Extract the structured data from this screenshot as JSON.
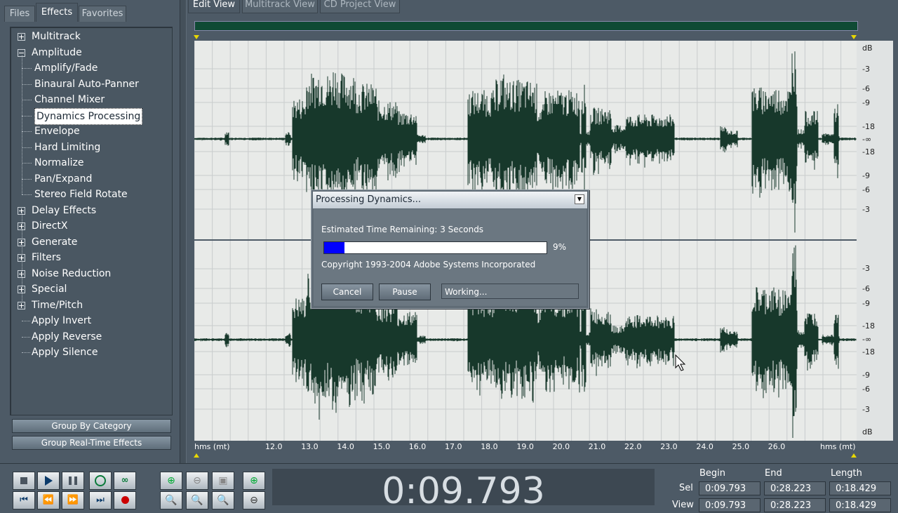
{
  "left_panel": {
    "tabs": [
      "Files",
      "Effects",
      "Favorites"
    ],
    "active_tab": "Effects",
    "tree": [
      {
        "label": "Multitrack",
        "level": 0,
        "expander": "plus"
      },
      {
        "label": "Amplitude",
        "level": 0,
        "expander": "minus"
      },
      {
        "label": "Amplify/Fade",
        "level": 1
      },
      {
        "label": "Binaural Auto-Panner",
        "level": 1
      },
      {
        "label": "Channel Mixer",
        "level": 1
      },
      {
        "label": "Dynamics Processing",
        "level": 1,
        "selected": true
      },
      {
        "label": "Envelope",
        "level": 1
      },
      {
        "label": "Hard Limiting",
        "level": 1
      },
      {
        "label": "Normalize",
        "level": 1
      },
      {
        "label": "Pan/Expand",
        "level": 1
      },
      {
        "label": "Stereo Field Rotate",
        "level": 1
      },
      {
        "label": "Delay Effects",
        "level": 0,
        "expander": "plus"
      },
      {
        "label": "DirectX",
        "level": 0,
        "expander": "plus"
      },
      {
        "label": "Generate",
        "level": 0,
        "expander": "plus"
      },
      {
        "label": "Filters",
        "level": 0,
        "expander": "plus"
      },
      {
        "label": "Noise Reduction",
        "level": 0,
        "expander": "plus"
      },
      {
        "label": "Special",
        "level": 0,
        "expander": "plus"
      },
      {
        "label": "Time/Pitch",
        "level": 0,
        "expander": "plus"
      },
      {
        "label": "Apply Invert",
        "level": 0
      },
      {
        "label": "Apply Reverse",
        "level": 0
      },
      {
        "label": "Apply Silence",
        "level": 0
      }
    ],
    "group_by_category_label": "Group By Category",
    "group_realtime_label": "Group Real-Time Effects"
  },
  "view_tabs": [
    "Edit View",
    "Multitrack View",
    "CD Project View"
  ],
  "active_view": "Edit View",
  "db_scale": {
    "top_channel": [
      "dB",
      "-3",
      "-6",
      "-9",
      "-18",
      "-∞",
      "-18",
      "-9",
      "-6",
      "-3"
    ],
    "bottom_channel": [
      "-3",
      "-6",
      "-9",
      "-18",
      "-∞",
      "-18",
      "-9",
      "-6",
      "-3",
      "dB"
    ]
  },
  "time_ruler": {
    "left_label": "hms (mt)",
    "right_label": "hms (mt)",
    "ticks": [
      "12.0",
      "13.0",
      "14.0",
      "15.0",
      "16.0",
      "17.0",
      "18.0",
      "19.0",
      "20.0",
      "21.0",
      "22.0",
      "23.0",
      "24.0",
      "25.0",
      "26.0"
    ]
  },
  "dialog": {
    "title": "Processing Dynamics...",
    "estimate": "Estimated Time Remaining: 3 Seconds",
    "progress_fraction": 0.09,
    "progress_label": "9%",
    "copyright": "Copyright 1993-2004 Adobe Systems Incorporated",
    "cancel_label": "Cancel",
    "pause_label": "Pause",
    "status": "Working..."
  },
  "transport": {
    "row1_icons": [
      "stop-icon",
      "play-icon",
      "pause-icon",
      "play-looped-icon",
      "loop-icon"
    ],
    "row2_icons": [
      "go-to-start-icon",
      "rewind-icon",
      "fast-forward-icon",
      "go-to-end-icon",
      "record-icon"
    ],
    "colors": {
      "play": "#0a3a6a",
      "record": "#cc0000",
      "zoom": "#00aa44"
    }
  },
  "time_display": "0:09.793",
  "selection": {
    "headers": [
      "Begin",
      "End",
      "Length"
    ],
    "row_label": "Sel",
    "begin": "0:09.793",
    "end": "0:28.223",
    "length": "0:18.429",
    "row2_label": "View",
    "row2_begin": "0:09.793",
    "row2_end": "0:28.223",
    "row2_length": "0:18.429"
  },
  "colors": {
    "waveform": "#17382b",
    "overview": "#0f4a34",
    "background": "#4d5a66",
    "progress": "#0000ff"
  }
}
